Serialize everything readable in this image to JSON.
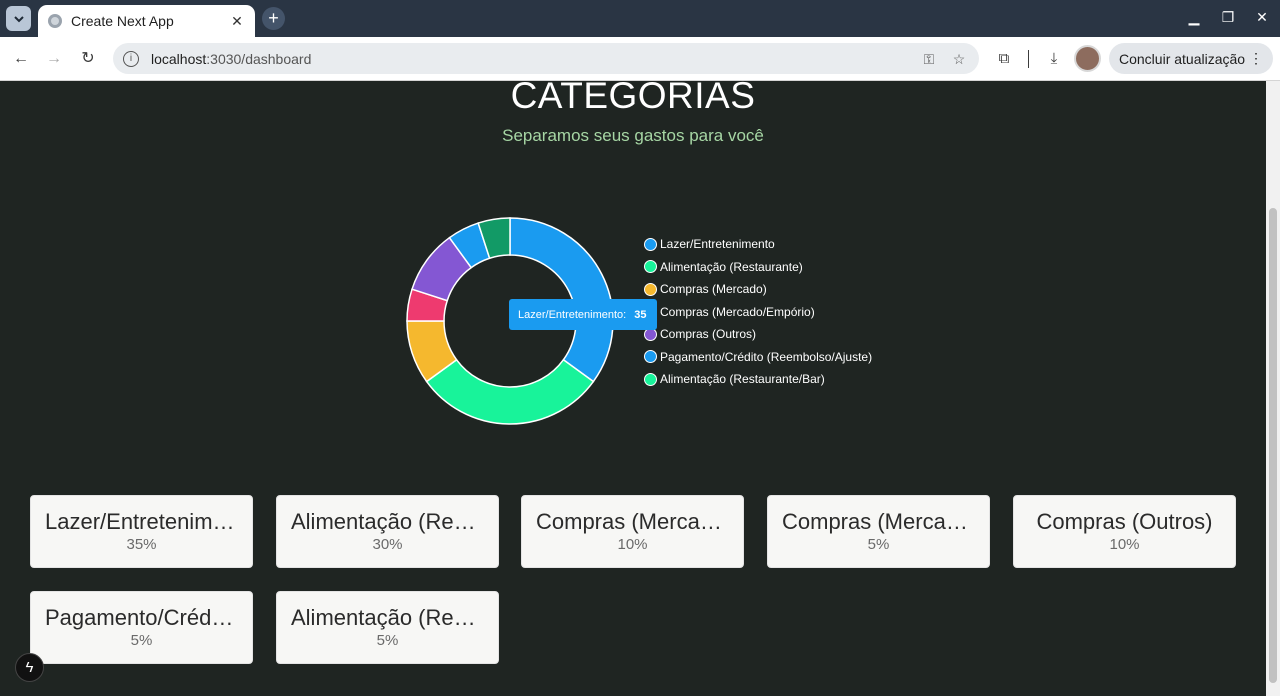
{
  "browser": {
    "tab_title": "Create Next App",
    "url_host": "localhost",
    "url_path": ":3030/dashboard",
    "update_button": "Concluir atualização"
  },
  "page": {
    "title": "CATEGORIAS",
    "subtitle": "Separamos seus gastos para você"
  },
  "chart_data": {
    "type": "pie",
    "categories": [
      "Lazer/Entretenimento",
      "Alimentação (Restaurante)",
      "Compras (Mercado)",
      "Compras (Mercado/Empório)",
      "Compras (Outros)",
      "Pagamento/Crédito (Reembolso/Ajuste)",
      "Alimentação (Restaurante/Bar)"
    ],
    "values": [
      35,
      30,
      10,
      5,
      10,
      5,
      5
    ],
    "colors": [
      "#1a9bf0",
      "#18f39a",
      "#f5b82e",
      "#ee3a6f",
      "#8457d3",
      "#1a9bf0",
      "#129a66"
    ],
    "legend_colors": [
      "#1a9bf0",
      "#18f39a",
      "#f5b82e",
      "#ee3a6f",
      "#8457d3",
      "#1a9bf0",
      "#18f39a"
    ],
    "legend_position": "right",
    "tooltip": {
      "label": "Lazer/Entretenimento:",
      "value": "35"
    }
  },
  "cards": [
    {
      "title": "Lazer/Entretenimento",
      "percent": "35%"
    },
    {
      "title": "Alimentação (Restaurante)",
      "percent": "30%"
    },
    {
      "title": "Compras (Mercado)",
      "percent": "10%"
    },
    {
      "title": "Compras (Mercado/Empório)",
      "percent": "5%"
    },
    {
      "title": "Compras (Outros)",
      "percent": "10%"
    },
    {
      "title": "Pagamento/Crédito (Reembolso/Ajuste)",
      "percent": "5%"
    },
    {
      "title": "Alimentação (Restaurante/Bar)",
      "percent": "5%"
    }
  ]
}
